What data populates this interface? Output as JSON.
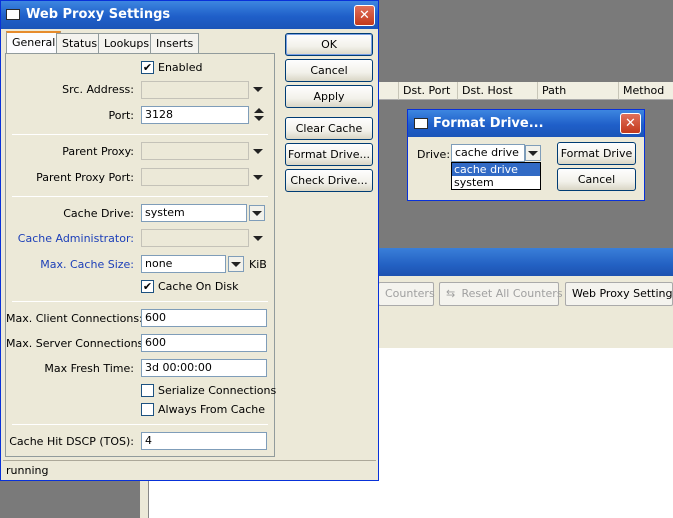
{
  "background_window": {
    "toolbar": {
      "reset_counters": "Counters",
      "reset_all_counters": "Reset All Counters",
      "web_proxy_settings": "Web Proxy Settings"
    },
    "columns": [
      "Dst. Port",
      "Dst. Host",
      "Path",
      "Method"
    ]
  },
  "settings_window": {
    "title": "Web Proxy Settings",
    "tabs": [
      "General",
      "Status",
      "Lookups",
      "Inserts"
    ],
    "enabled": {
      "label": "Enabled",
      "checked": true
    },
    "src_address": {
      "label": "Src. Address:",
      "value": ""
    },
    "port": {
      "label": "Port:",
      "value": "3128"
    },
    "parent_proxy": {
      "label": "Parent Proxy:",
      "value": ""
    },
    "parent_proxy_port": {
      "label": "Parent Proxy Port:",
      "value": ""
    },
    "cache_drive": {
      "label": "Cache Drive:",
      "value": "system"
    },
    "cache_administrator": {
      "label": "Cache Administrator:",
      "value": ""
    },
    "max_cache_size": {
      "label": "Max. Cache Size:",
      "value": "none",
      "unit": "KiB"
    },
    "cache_on_disk": {
      "label": "Cache On Disk",
      "checked": true
    },
    "max_client_connections": {
      "label": "Max. Client Connections:",
      "value": "600"
    },
    "max_server_connections": {
      "label": "Max. Server Connections:",
      "value": "600"
    },
    "max_fresh_time": {
      "label": "Max Fresh Time:",
      "value": "3d 00:00:00"
    },
    "serialize_connections": {
      "label": "Serialize Connections",
      "checked": false
    },
    "always_from_cache": {
      "label": "Always From Cache",
      "checked": false
    },
    "cache_hit_dscp": {
      "label": "Cache Hit DSCP (TOS):",
      "value": "4"
    },
    "buttons": {
      "ok": "OK",
      "cancel": "Cancel",
      "apply": "Apply",
      "clear_cache": "Clear Cache",
      "format_drive": "Format Drive...",
      "check_drive": "Check Drive..."
    },
    "status": "running",
    "check_glyph": "✔"
  },
  "format_dialog": {
    "title": "Format Drive...",
    "drive_label": "Drive:",
    "drive_value": "cache drive",
    "options": [
      "cache drive",
      "system"
    ],
    "selected_index": 0,
    "buttons": {
      "format": "Format Drive",
      "cancel": "Cancel"
    }
  },
  "colors": {
    "title_bar": "#1f5fc9",
    "close_button": "#c3391c",
    "link_label": "#1c3fb8",
    "selection": "#316ac5"
  }
}
